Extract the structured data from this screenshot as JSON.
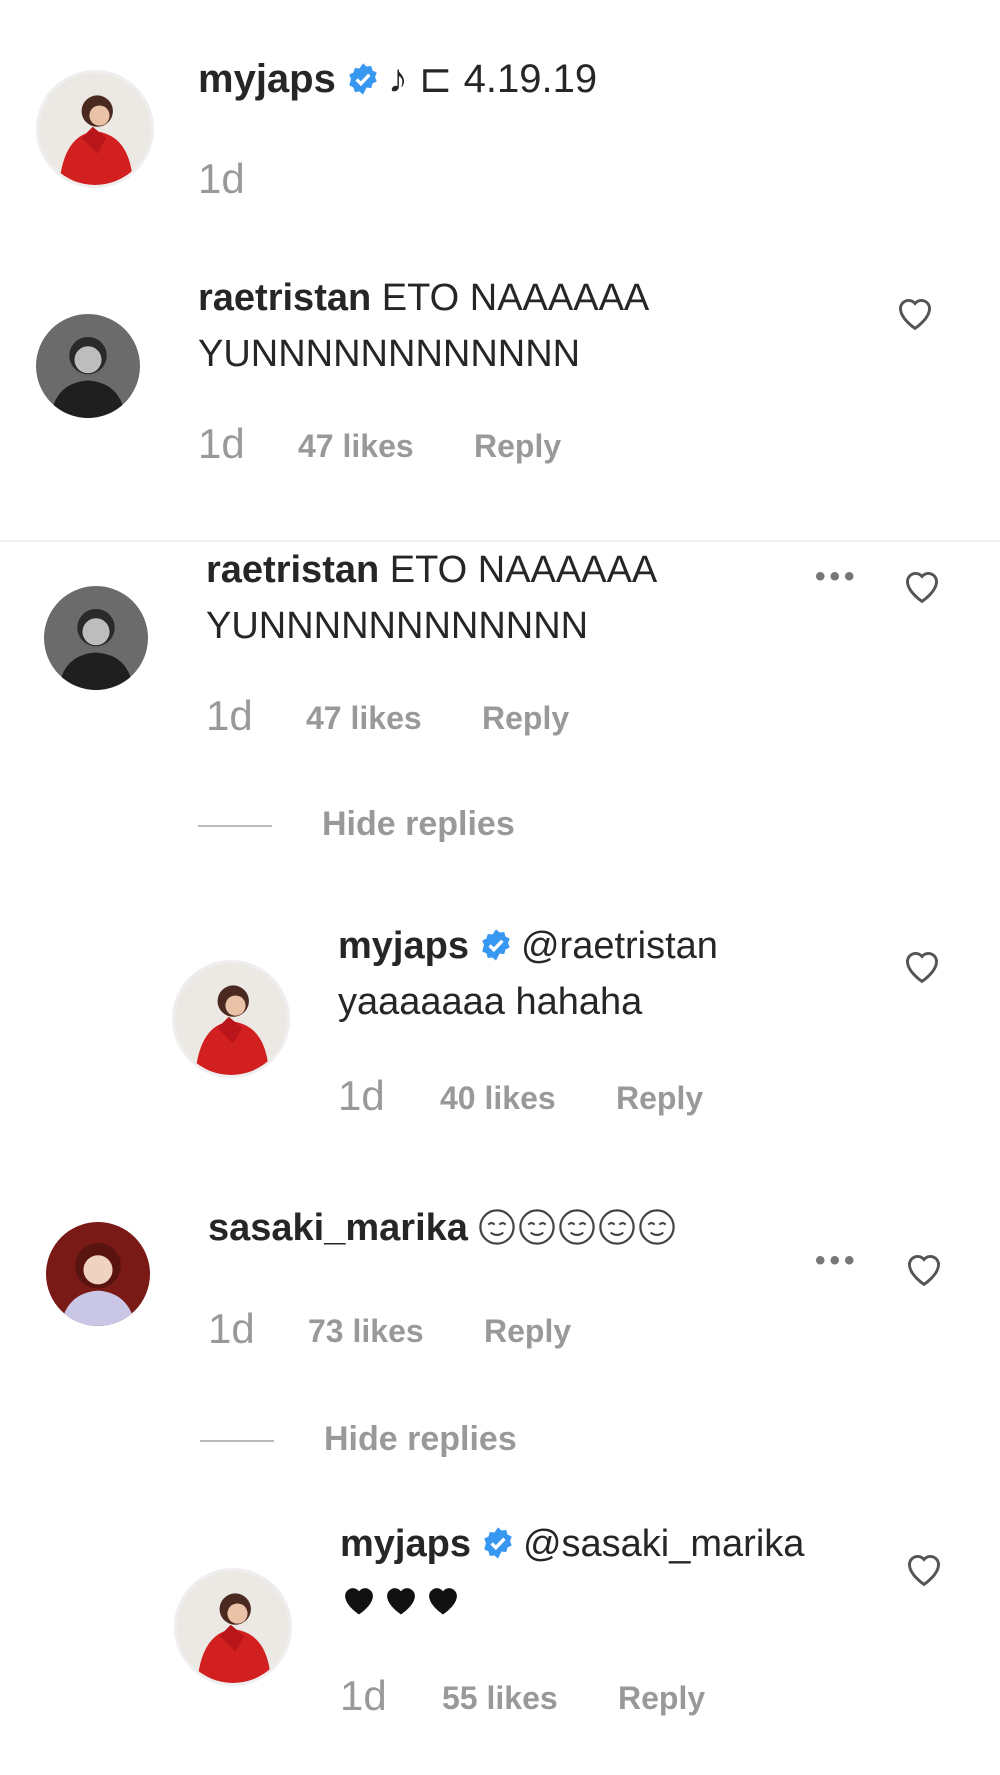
{
  "post_caption": {
    "username": "myjaps",
    "text": "♪ ⊏ 4.19.19",
    "time": "1d"
  },
  "comment1": {
    "username": "raetristan",
    "text_line1": "ETO NAAAAAA",
    "text_line2": "YUNNNNNNNNNNNN",
    "time": "1d",
    "likes": "47 likes",
    "reply": "Reply"
  },
  "comment2": {
    "username": "raetristan",
    "text_line1": "ETO NAAAAAA",
    "text_line2": "YUNNNNNNNNNNNN",
    "time": "1d",
    "likes": "47 likes",
    "reply": "Reply",
    "hide_replies": "Hide replies"
  },
  "reply1": {
    "username": "myjaps",
    "mention": "@raetristan",
    "text": "yaaaaaaa hahaha",
    "time": "1d",
    "likes": "40 likes",
    "reply": "Reply"
  },
  "comment3": {
    "username": "sasaki_marika",
    "time": "1d",
    "likes": "73 likes",
    "reply": "Reply",
    "hide_replies": "Hide replies",
    "emoji_icon": "relieved-face-icon"
  },
  "reply2": {
    "username": "myjaps",
    "mention": "@sasaki_marika",
    "time": "1d",
    "likes": "55 likes",
    "reply": "Reply",
    "emoji_icon": "black-heart-icon"
  },
  "colors": {
    "verified": "#3897f0",
    "muted": "#999999",
    "text": "#262626"
  }
}
